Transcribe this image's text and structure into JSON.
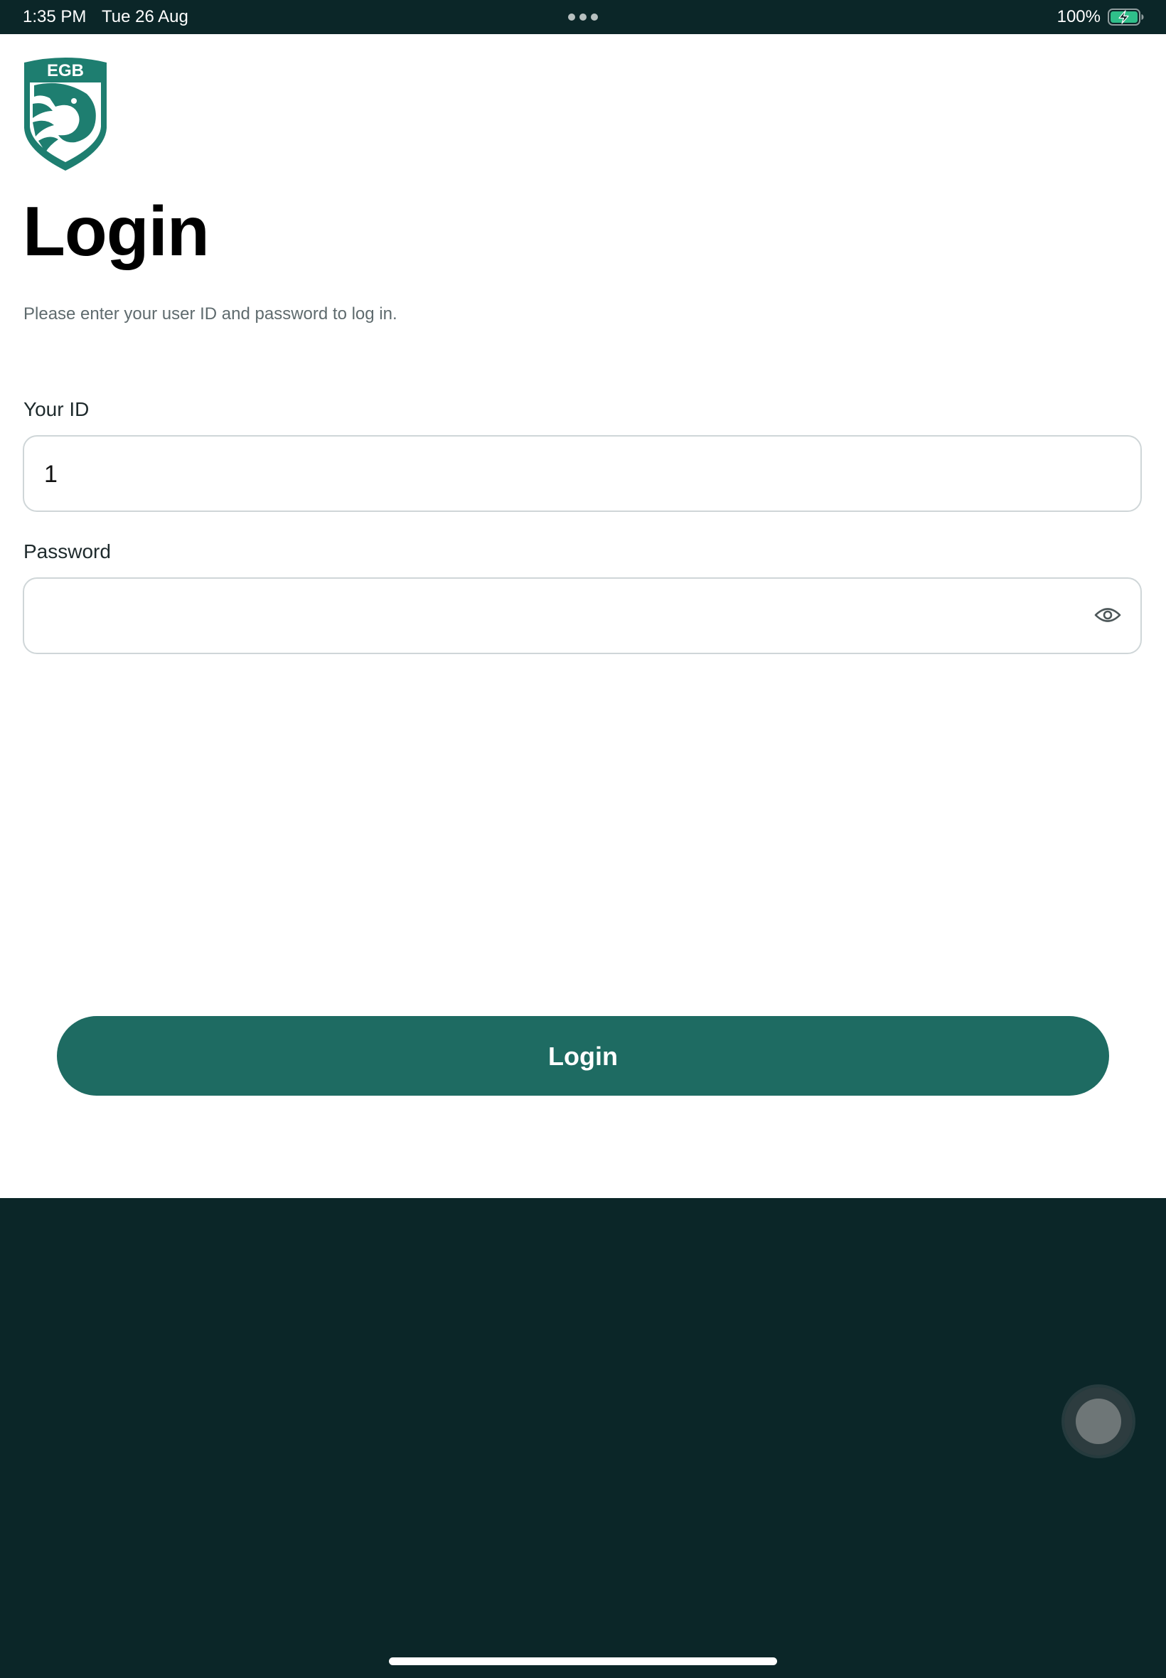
{
  "status_bar": {
    "time": "1:35 PM",
    "date": "Tue 26 Aug",
    "battery_percent": "100%",
    "battery_level": 1.0,
    "battery_icon": "battery-charging-icon"
  },
  "logo": {
    "text": "EGB",
    "icon": "eagle-shield-logo",
    "color": "#1e7e70"
  },
  "login": {
    "title": "Login",
    "subtitle": "Please enter your user ID and password to log in.",
    "id_label": "Your ID",
    "id_value": "1",
    "password_label": "Password",
    "password_value": "",
    "password_toggle_icon": "eye-icon",
    "button_label": "Login"
  },
  "colors": {
    "accent": "#1e6b62",
    "background_dark": "#0b2628",
    "input_border": "#cfd6d8"
  }
}
